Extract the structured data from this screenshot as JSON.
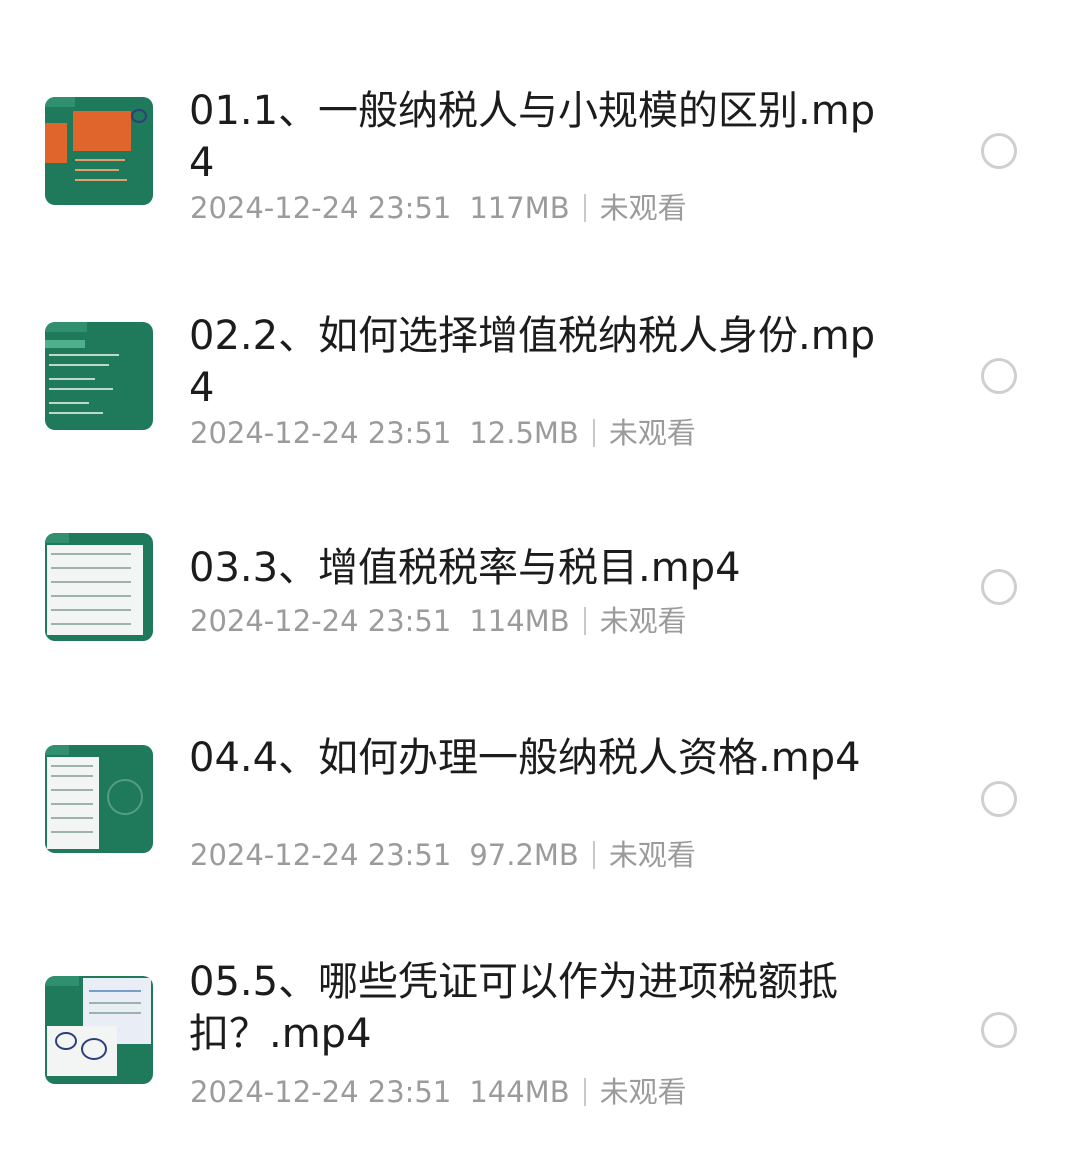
{
  "items": [
    {
      "title": "01.1、一般纳税人与小规模的区别.mp4",
      "date": "2024-12-24 23:51",
      "size": "117MB",
      "status": "未观看",
      "selected": false
    },
    {
      "title": "02.2、如何选择增值税纳税人身份.mp4",
      "date": "2024-12-24 23:51",
      "size": "12.5MB",
      "status": "未观看",
      "selected": false
    },
    {
      "title": "03.3、增值税税率与税目.mp4",
      "date": "2024-12-24 23:51",
      "size": "114MB",
      "status": "未观看",
      "selected": false
    },
    {
      "title": "04.4、如何办理一般纳税人资格.mp4",
      "date": "2024-12-24 23:51",
      "size": "97.2MB",
      "status": "未观看",
      "selected": false
    },
    {
      "title": "05.5、哪些凭证可以作为进项税额抵扣？.mp4",
      "date": "2024-12-24 23:51",
      "size": "144MB",
      "status": "未观看",
      "selected": false
    }
  ],
  "colors": {
    "thumb_bg": "#1f7a5c",
    "title": "#1c1c1c",
    "meta": "#9b9b9b",
    "radio_border": "#cfcfcf"
  },
  "icons": {
    "thumbnail": "video-thumbnail-icon",
    "select": "radio-circle-icon"
  }
}
